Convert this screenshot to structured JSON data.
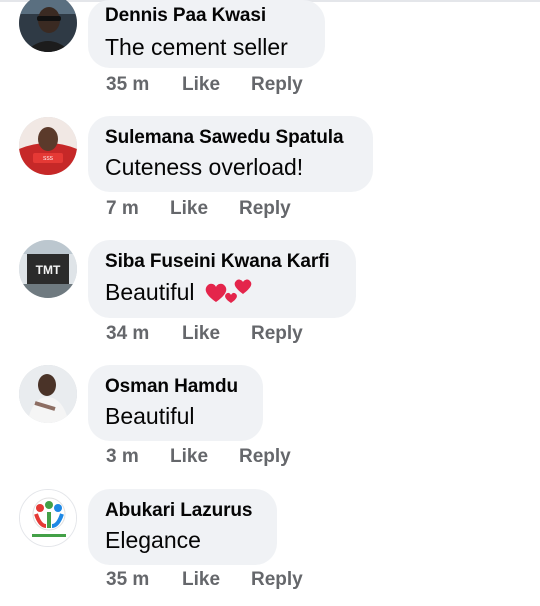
{
  "comments": [
    {
      "author": "Dennis Paa Kwasi",
      "text": "The cement seller",
      "time": "35 m",
      "like_label": "Like",
      "reply_label": "Reply",
      "avatar": "avatar-photo-dark"
    },
    {
      "author": "Sulemana Sawedu Spatula",
      "text": "Cuteness overload!",
      "time": "7 m",
      "like_label": "Like",
      "reply_label": "Reply",
      "avatar": "avatar-photo-red"
    },
    {
      "author": "Siba Fuseini Kwana Karfi",
      "text": "Beautiful",
      "emoji": "two-hearts",
      "time": "34 m",
      "like_label": "Like",
      "reply_label": "Reply",
      "avatar": "avatar-photo-tmt-sign"
    },
    {
      "author": "Osman Hamdu",
      "text": "Beautiful",
      "time": "3 m",
      "like_label": "Like",
      "reply_label": "Reply",
      "avatar": "avatar-photo-man"
    },
    {
      "author": "Abukari Lazurus",
      "text": "Elegance",
      "time": "35 m",
      "like_label": "Like",
      "reply_label": "Reply",
      "avatar": "avatar-logo-people"
    }
  ],
  "colors": {
    "bubble": "#f0f2f5",
    "name": "#050505",
    "meta": "#65676b",
    "heart": "#e4254b"
  }
}
